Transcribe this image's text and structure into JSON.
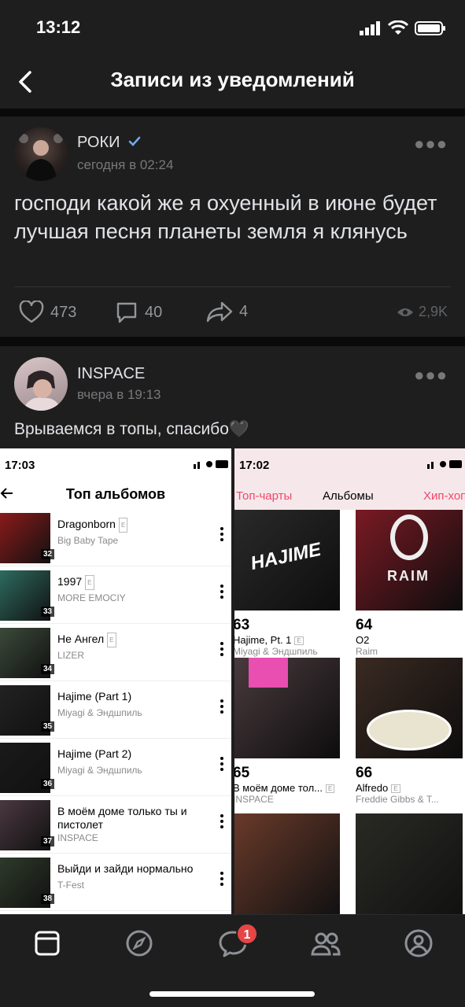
{
  "status_bar": {
    "time": "13:12"
  },
  "header": {
    "title": "Записи из уведомлений"
  },
  "posts": [
    {
      "author": "РОКИ",
      "verified": true,
      "date": "сегодня в 02:24",
      "text": "господи какой же я охуенный в июне будет лучшая песня планеты земля я клянусь",
      "likes": "473",
      "comments": "40",
      "shares": "4",
      "views": "2,9K"
    },
    {
      "author": "INSPACE",
      "date": "вчера в 19:13",
      "text": "Врываемся в топы, спасибо🖤"
    }
  ],
  "shot_left": {
    "time": "17:03",
    "title": "Топ альбомов",
    "explicit": "E",
    "rows": [
      {
        "name": "Dragonborn",
        "artist": "Big Baby Tape",
        "num": "32",
        "color": "#8b1a1a"
      },
      {
        "name": "1997",
        "artist": "MORE EMOCIY",
        "num": "33",
        "color": "#2d6b5f"
      },
      {
        "name": "Не Ангел",
        "artist": "LIZER",
        "num": "34",
        "color": "#3b4a3a"
      },
      {
        "name": "Hajime (Part 1)",
        "artist": "Miyagi & Эндшпиль",
        "num": "35",
        "color": "#222222"
      },
      {
        "name": "Hajime (Part 2)",
        "artist": "Miyagi & Эндшпиль",
        "num": "36",
        "color": "#1a1a1a"
      },
      {
        "name": "В моём доме только ты и пистолет",
        "artist": "INSPACE",
        "num": "37",
        "color": "#4a3840"
      },
      {
        "name": "Выйди и зайди нормально",
        "artist": "T-Fest",
        "num": "38",
        "color": "#2e3a2a"
      }
    ]
  },
  "shot_right": {
    "time": "17:02",
    "tabs": [
      "Топ-чарты",
      "Альбомы",
      "Хип-хоп"
    ],
    "explicit": "E",
    "albums": [
      {
        "num": "63",
        "name": "Hajime, Pt. 1",
        "artist": "Miyagi & Эндшпиль",
        "color": "#2a2a2a"
      },
      {
        "num": "64",
        "name": "O2",
        "artist": "Raim",
        "color": "#7a1a24"
      },
      {
        "num": "65",
        "name": "В моём доме тол...",
        "artist": "INSPACE",
        "color": "#4a3a3e"
      },
      {
        "num": "66",
        "name": "Alfredo",
        "artist": "Freddie Gibbs & T...",
        "color": "#3a2a22"
      }
    ],
    "raim_label": "RAIM",
    "hajime_label": "HAJIME"
  },
  "nav": {
    "badge": "1"
  },
  "colors": {
    "bg": "#1e1e1f",
    "accent": "#e64646",
    "verified": "#71aaeb",
    "pink_tab": "#f2466b"
  }
}
